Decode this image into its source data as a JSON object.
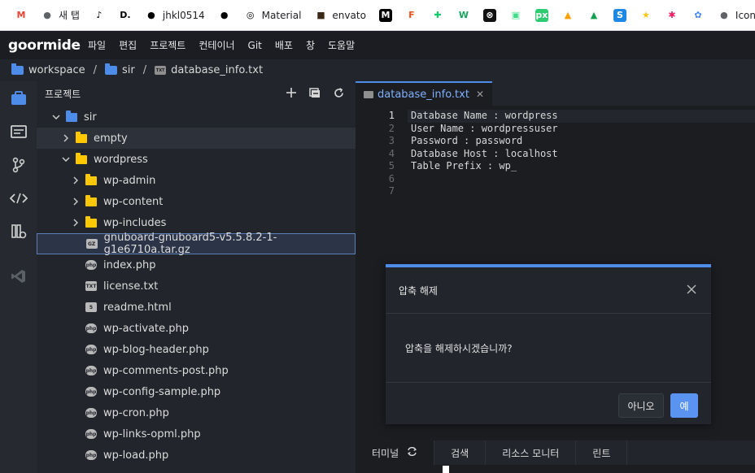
{
  "bookmarks": [
    {
      "label": "",
      "glyph": "M",
      "color": "#ea4335",
      "bg": "#ffffff"
    },
    {
      "label": "새 탭",
      "glyph": "●",
      "color": "#5f6368",
      "bg": "#ffffff"
    },
    {
      "label": "",
      "glyph": "♪",
      "color": "#000000",
      "bg": "#ffffff"
    },
    {
      "label": "",
      "glyph": "D.",
      "color": "#000000",
      "bg": "#ffffff"
    },
    {
      "label": "jhkl0514",
      "glyph": "●",
      "color": "#000000",
      "bg": "#ffffff"
    },
    {
      "label": "",
      "glyph": "●",
      "color": "#000000",
      "bg": "#ffffff"
    },
    {
      "label": "Material",
      "glyph": "◎",
      "color": "#000000",
      "bg": "#ffffff"
    },
    {
      "label": "envato",
      "glyph": "■",
      "color": "#3b2a1a",
      "bg": "#ffffff"
    },
    {
      "label": "",
      "glyph": "M",
      "color": "#ffffff",
      "bg": "#000000"
    },
    {
      "label": "",
      "glyph": "F",
      "color": "#f24e1e",
      "bg": "#ffffff"
    },
    {
      "label": "",
      "glyph": "✚",
      "color": "#0cce6b",
      "bg": "#ffffff"
    },
    {
      "label": "",
      "glyph": "W",
      "color": "#1aa260",
      "bg": "#ffffff"
    },
    {
      "label": "",
      "glyph": "⊗",
      "color": "#ffffff",
      "bg": "#111111"
    },
    {
      "label": "",
      "glyph": "▣",
      "color": "#3ddc84",
      "bg": "#ffffff"
    },
    {
      "label": "",
      "glyph": "px",
      "color": "#ffffff",
      "bg": "#2ecc71"
    },
    {
      "label": "",
      "glyph": "▲",
      "color": "#ffa000",
      "bg": "#ffffff"
    },
    {
      "label": "",
      "glyph": "▲",
      "color": "#12a150",
      "bg": "#ffffff"
    },
    {
      "label": "",
      "glyph": "S",
      "color": "#ffffff",
      "bg": "#1e88e5"
    },
    {
      "label": "",
      "glyph": "★",
      "color": "#f9c513",
      "bg": "#ffffff"
    },
    {
      "label": "",
      "glyph": "✱",
      "color": "#e91e63",
      "bg": "#ffffff"
    },
    {
      "label": "",
      "glyph": "✿",
      "color": "#4285f4",
      "bg": "#ffffff"
    },
    {
      "label": "Icons",
      "glyph": "●",
      "color": "#5f6368",
      "bg": "#ffffff"
    }
  ],
  "app": {
    "logo": "goormide",
    "menu": [
      "파일",
      "편집",
      "프로젝트",
      "컨테이너",
      "Git",
      "배포",
      "창",
      "도움말"
    ]
  },
  "breadcrumb": [
    "workspace",
    "sir",
    "database_info.txt"
  ],
  "explorer": {
    "title": "프로젝트",
    "tree": [
      {
        "label": "sir",
        "type": "folder-blue",
        "indent": 0,
        "chevron": "down"
      },
      {
        "label": "empty",
        "type": "folder",
        "indent": 1,
        "chevron": "right",
        "state": "hover"
      },
      {
        "label": "wordpress",
        "type": "folder",
        "indent": 1,
        "chevron": "down"
      },
      {
        "label": "wp-admin",
        "type": "folder",
        "indent": 2,
        "chevron": "right"
      },
      {
        "label": "wp-content",
        "type": "folder",
        "indent": 2,
        "chevron": "right"
      },
      {
        "label": "wp-includes",
        "type": "folder",
        "indent": 2,
        "chevron": "right"
      },
      {
        "label": "gnuboard-gnuboard5-v5.5.8.2-1-g1e6710a.tar.gz",
        "type": "file",
        "badge": "GZ",
        "indent": 2,
        "state": "selected"
      },
      {
        "label": "index.php",
        "type": "file",
        "badge": "php",
        "indent": 2
      },
      {
        "label": "license.txt",
        "type": "file",
        "badge": "TXT",
        "indent": 2
      },
      {
        "label": "readme.html",
        "type": "file",
        "badge": "5",
        "indent": 2
      },
      {
        "label": "wp-activate.php",
        "type": "file",
        "badge": "php",
        "indent": 2
      },
      {
        "label": "wp-blog-header.php",
        "type": "file",
        "badge": "php",
        "indent": 2
      },
      {
        "label": "wp-comments-post.php",
        "type": "file",
        "badge": "php",
        "indent": 2
      },
      {
        "label": "wp-config-sample.php",
        "type": "file",
        "badge": "php",
        "indent": 2
      },
      {
        "label": "wp-cron.php",
        "type": "file",
        "badge": "php",
        "indent": 2
      },
      {
        "label": "wp-links-opml.php",
        "type": "file",
        "badge": "php",
        "indent": 2
      },
      {
        "label": "wp-load.php",
        "type": "file",
        "badge": "php",
        "indent": 2
      }
    ]
  },
  "editor": {
    "tab": "database_info.txt",
    "lines": [
      "Database Name : wordpress",
      "User Name : wordpressuser",
      "Password : password",
      "Database Host : localhost",
      "Table Prefix : wp_",
      "",
      ""
    ],
    "line_numbers": [
      "1",
      "2",
      "3",
      "4",
      "5",
      "6",
      "7"
    ]
  },
  "dialog": {
    "title": "압축 해제",
    "message": "압축을 해제하시겠습니까?",
    "no": "아니오",
    "yes": "예"
  },
  "bottom_tabs": [
    "터미널",
    "검색",
    "리소스 모니터",
    "린트"
  ]
}
